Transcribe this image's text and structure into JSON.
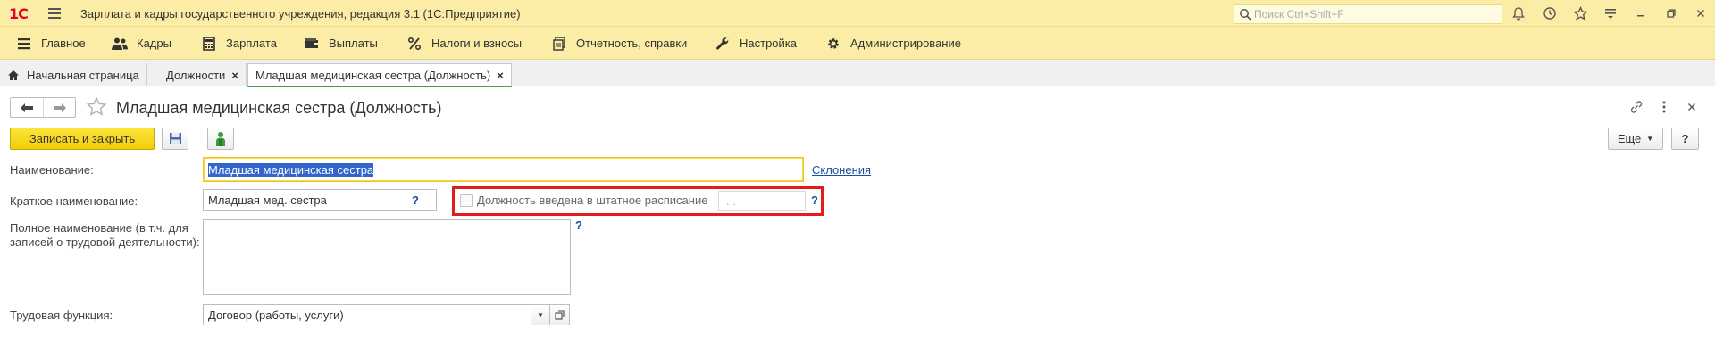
{
  "app": {
    "logo": "1С",
    "title": "Зарплата и кадры государственного учреждения, редакция 3.1  (1С:Предприятие)",
    "search_placeholder": "Поиск Ctrl+Shift+F"
  },
  "menu": {
    "items": [
      {
        "label": "Главное",
        "icon": "menu-icon"
      },
      {
        "label": "Кадры",
        "icon": "people-icon"
      },
      {
        "label": "Зарплата",
        "icon": "calculator-icon"
      },
      {
        "label": "Выплаты",
        "icon": "wallet-icon"
      },
      {
        "label": "Налоги и взносы",
        "icon": "percent-icon"
      },
      {
        "label": "Отчетность, справки",
        "icon": "reports-icon"
      },
      {
        "label": "Настройка",
        "icon": "wrench-icon"
      },
      {
        "label": "Администрирование",
        "icon": "gear-icon"
      }
    ]
  },
  "tabs": {
    "home": "Начальная страница",
    "positions": "Должности",
    "current": "Младшая медицинская сестра (Должность)",
    "close_glyph": "×"
  },
  "form": {
    "title": "Младшая медицинская сестра (Должность)",
    "save_close": "Записать и закрыть",
    "more": "Еще",
    "help": "?",
    "name_label": "Наименование:",
    "name_value": "Младшая медицинская сестра",
    "declensions_link": "Склонения",
    "short_label": "Краткое наименование:",
    "short_value": "Младшая мед. сестра",
    "question_mark": "?",
    "staff_checkbox_label": "Должность введена в штатное расписание",
    "staff_checked": false,
    "date_placeholder": " .  .",
    "full_label_line1": "Полное наименование (в т.ч. для",
    "full_label_line2": "записей о трудовой деятельности):",
    "full_value": "",
    "labor_label": "Трудовая функция:",
    "labor_value": "Договор (работы, услуги)"
  },
  "colors": {
    "titlebar_bg": "#fbeca6",
    "primary_button": "#f5d413",
    "highlight_frame": "#e31c1c",
    "link": "#1a4f9c",
    "active_tab_underline": "#4a9b4a"
  }
}
